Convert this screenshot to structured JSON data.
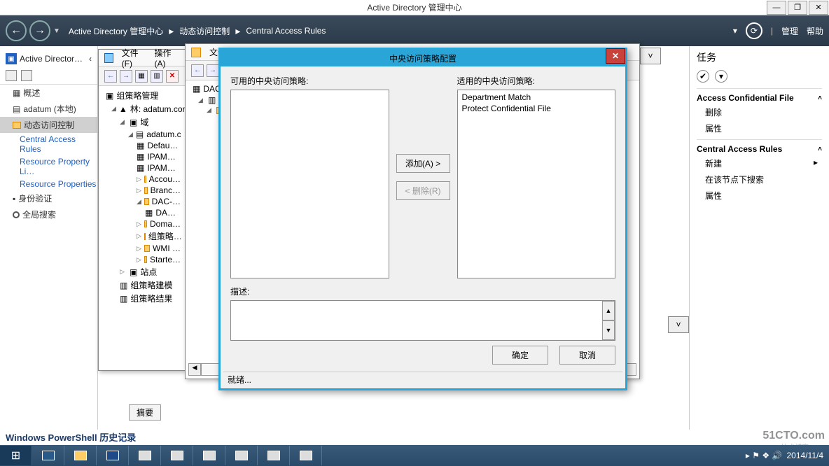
{
  "titlebar": {
    "title": "Active Directory 管理中心"
  },
  "header": {
    "breadcrumb": [
      "Active Directory 管理中心",
      "动态访问控制",
      "Central Access Rules"
    ],
    "manage": "管理",
    "help": "帮助"
  },
  "left_panel": {
    "title": "Active Director…",
    "items": {
      "overview": "概述",
      "adatum": "adatum (本地)",
      "dac": "动态访问控制",
      "car": "Central Access Rules",
      "rpl": "Resource Property Li…",
      "rp": "Resource Properties",
      "auth": "身份验证",
      "global_search": "全局搜索"
    }
  },
  "gpmc_window": {
    "menu_file": "文件(F)",
    "menu_action": "操作(A)",
    "root": "组策略管理",
    "forest": "林: adatum.com",
    "domains": "域",
    "domain": "adatum.c",
    "gpos": [
      "Defau…",
      "IPAM…",
      "IPAM…",
      "Accou…",
      "Branc…",
      "DAC-…",
      "DA…",
      "Doma…",
      "组策略…",
      "WMI …",
      "Starte…"
    ],
    "sites": "站点",
    "modeling": "组策略建模",
    "results": "组策略结果"
  },
  "dac_window": {
    "menu_file": "文件(F)",
    "item": "DAC"
  },
  "modal": {
    "title": "中央访问策略配置",
    "available_label": "可用的中央访问策略:",
    "applied_label": "适用的中央访问策略:",
    "applied_items": [
      "Department Match",
      "Protect Confidential File"
    ],
    "btn_add": "添加(A) >",
    "btn_remove": "< 删除(R)",
    "desc_label": "描述:",
    "btn_ok": "确定",
    "btn_cancel": "取消",
    "status": "就绪..."
  },
  "tasks": {
    "title": "任务",
    "section1": "Access Confidential File",
    "s1_items": [
      "删除",
      "属性"
    ],
    "section2": "Central Access Rules",
    "s2_items": [
      "新建",
      "在该节点下搜索",
      "属性"
    ]
  },
  "summary_tab": "摘要",
  "ps_history": "Windows PowerShell 历史记录",
  "tray_date": "2014/11/4",
  "watermark": "51CTO.com",
  "watermark2": "技术博客  Blog"
}
